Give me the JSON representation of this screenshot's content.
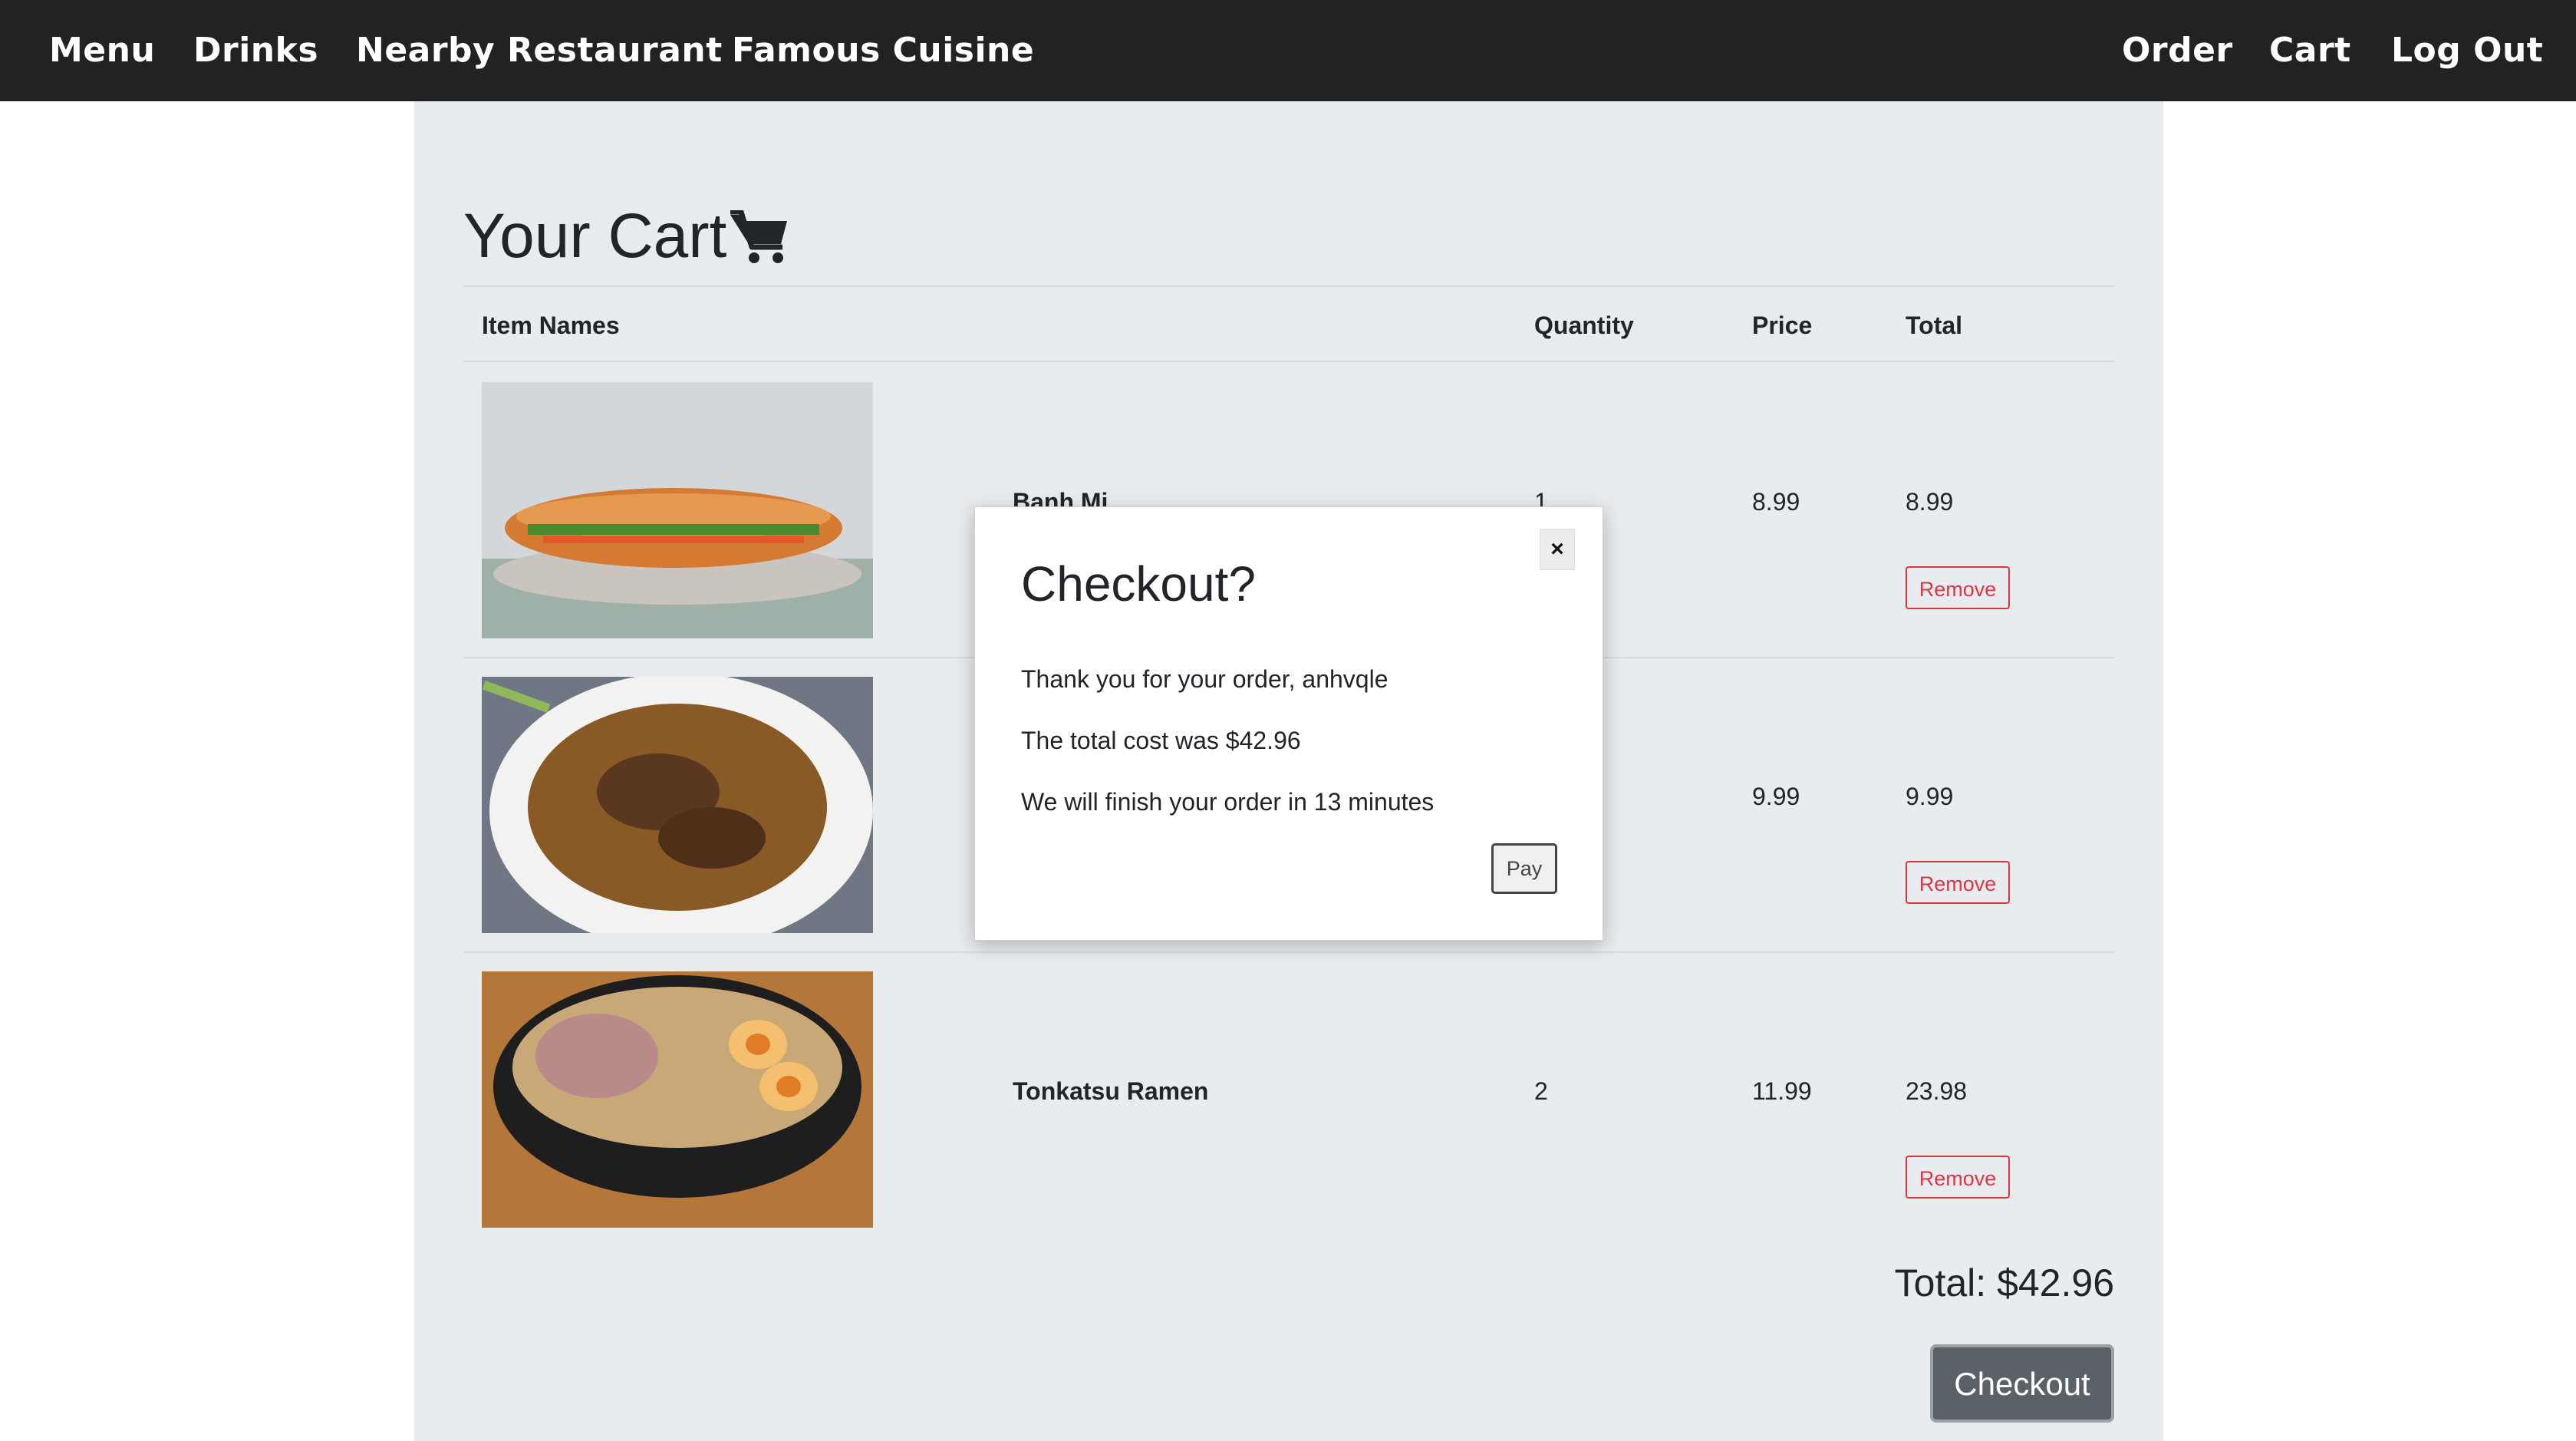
{
  "nav": {
    "left": [
      "Menu",
      "Drinks",
      "Nearby Restaurant",
      "Famous Cuisine"
    ],
    "right": [
      "Order",
      "Cart",
      "Log Out"
    ]
  },
  "cart": {
    "title": "Your Cart",
    "icon": "shopping-cart-icon",
    "headers": {
      "item_names": "Item Names",
      "quantity": "Quantity",
      "price": "Price",
      "total": "Total"
    },
    "items": [
      {
        "name": "Banh Mi",
        "quantity": "1",
        "price": "8.99",
        "total": "8.99",
        "remove_label": "Remove",
        "image": "banh-mi-photo"
      },
      {
        "name": "",
        "quantity": "",
        "price": "9.99",
        "total": "9.99",
        "remove_label": "Remove",
        "image": "stir-fried-noodles-photo"
      },
      {
        "name": "Tonkatsu Ramen",
        "quantity": "2",
        "price": "11.99",
        "total": "23.98",
        "remove_label": "Remove",
        "image": "ramen-photo"
      }
    ],
    "grand_total": "Total: $42.96",
    "checkout_label": "Checkout"
  },
  "modal": {
    "title": "Checkout?",
    "close_label": "×",
    "line1": "Thank you for your order, anhvqle",
    "line2": "The total cost was $42.96",
    "line3": "We will finish your order in 13 minutes",
    "pay_label": "Pay"
  },
  "colors": {
    "navbar": "#222222",
    "panel": "#e9ecef",
    "remove": "#dc3545",
    "checkout": "#5a6268"
  }
}
